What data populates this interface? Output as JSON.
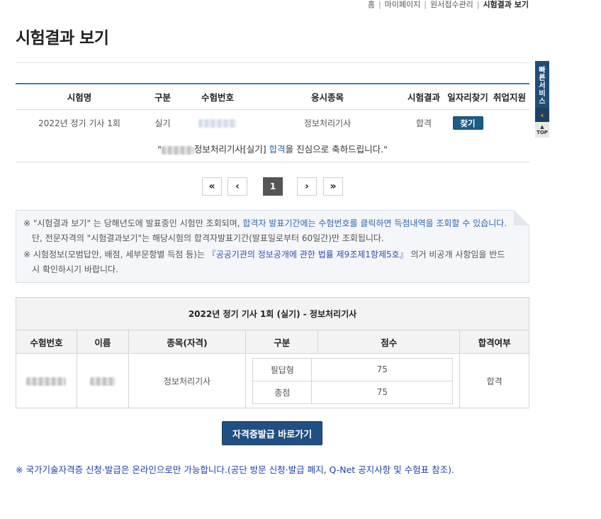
{
  "breadcrumb": [
    "홈",
    "마이페이지",
    "원서접수관리",
    "시험결과 보기"
  ],
  "page_title": "시험결과 보기",
  "result_table": {
    "headers": [
      "시험명",
      "구분",
      "수험번호",
      "응시종목",
      "시험결과",
      "일자리찾기",
      "취업지원"
    ],
    "row": {
      "exam_name": "2022년 정기 기사 1회",
      "type": "실기",
      "subject": "정보처리기사",
      "result": "합격",
      "job_button": "찾기"
    }
  },
  "congrats": {
    "open_quote": "\"",
    "exam": "정보처리기사[실기]",
    "passed": "합격",
    "tail": "을 진심으로 축하드립니다.\""
  },
  "pagination": {
    "first": "«",
    "prev": "‹",
    "current": "1",
    "next": "›",
    "last": "»"
  },
  "notice": {
    "line1_a": "※ \"시험결과 보기\" 는 당해년도에 발표중인 시험만 조회되며, ",
    "line1_link": "합격자 발표기간에는 수험번호를 클릭하면 득점내역을 조회할 수 있습니다.",
    "line1_b": " 단, 전문자격의 \"시험결과보기\"는 해당시험의 합격자발표기간(발표일로부터 60일간)만 조회됩니다.",
    "line2_a": "※ 시험정보(모범답안, 배점, 세부문항별 득점 등)는 ",
    "line2_law": "『공공기관의 정보공개에 관한 법률 제9조제1항제5호』",
    "line2_b": " 의거 비공개 사항임을 반드시 확인하시기 바랍니다."
  },
  "detail": {
    "caption": "2022년 정기 기사 1회 (실기) - 정보처리기사",
    "headers": [
      "수험번호",
      "이름",
      "종목(자격)",
      "구분",
      "점수",
      "합격여부"
    ],
    "subject": "정보처리기사",
    "scores": [
      {
        "label": "필답형",
        "score": "75"
      },
      {
        "label": "총점",
        "score": "75"
      }
    ],
    "pass": "합격"
  },
  "cert_button": "자격증발급 바로가기",
  "footer_note": "※ 국가기술자격증 신청·발급은 온라인으로만 가능합니다.(공단 방문 신청·발급 폐지, Q-Net 공지사항 및 수험표 참조).",
  "quick_menu": {
    "label": "빠른서비스",
    "arrow": "‹",
    "top_arrow": "▲",
    "top": "TOP"
  }
}
